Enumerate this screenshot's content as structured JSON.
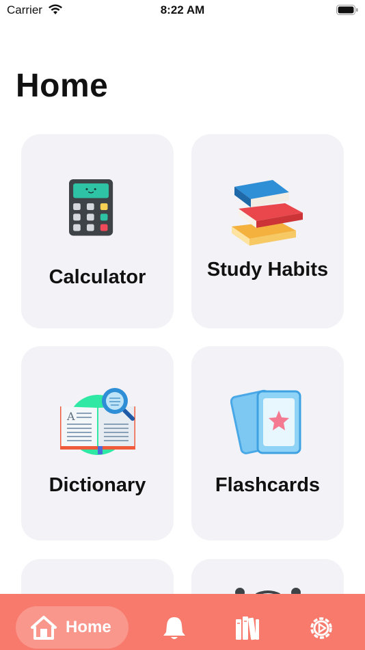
{
  "status_bar": {
    "carrier": "Carrier",
    "time": "8:22 AM"
  },
  "page": {
    "title": "Home"
  },
  "tiles": [
    {
      "label": "Calculator",
      "icon": "calculator-icon"
    },
    {
      "label": "Study Habits",
      "icon": "books-stack-icon"
    },
    {
      "label": "Dictionary",
      "icon": "dictionary-icon"
    },
    {
      "label": "Flashcards",
      "icon": "flashcards-icon"
    }
  ],
  "tab_bar": {
    "home_label": "Home",
    "items": [
      "home-icon",
      "bell-icon",
      "library-icon",
      "settings-icon"
    ]
  },
  "colors": {
    "tab_bar": "#f87a6c",
    "tile_bg": "#f2f2f7"
  }
}
